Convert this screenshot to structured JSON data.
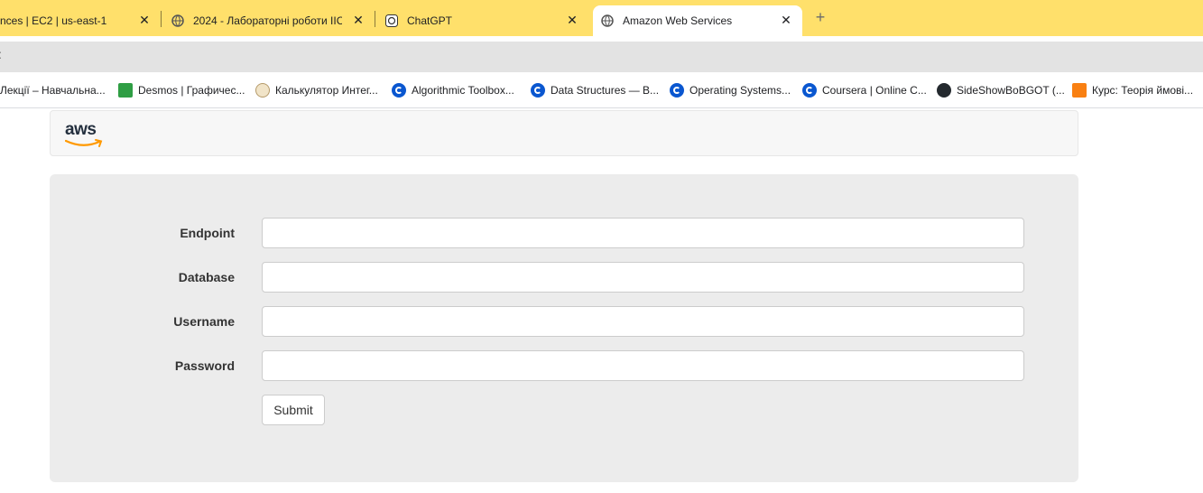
{
  "tabs": [
    {
      "title": "nces | EC2 | us-east-1",
      "active": false
    },
    {
      "title": "2024 - Лабораторні роботи ІІС",
      "active": false
    },
    {
      "title": "ChatGPT",
      "active": false
    },
    {
      "title": "Amazon Web Services",
      "active": true
    }
  ],
  "tab_close_glyph": "✕",
  "new_tab_glyph": "+",
  "omnibox_fragment": ":",
  "bookmarks": [
    {
      "label": "Лекції – Навчальна...",
      "icon": "none-icon"
    },
    {
      "label": "Desmos | Графичес...",
      "icon": "desmos-icon"
    },
    {
      "label": "Калькулятор Интег...",
      "icon": "calculator-icon"
    },
    {
      "label": "Algorithmic Toolbox...",
      "icon": "coursera-icon"
    },
    {
      "label": "Data Structures — B...",
      "icon": "coursera-icon"
    },
    {
      "label": "Operating Systems...",
      "icon": "coursera-icon"
    },
    {
      "label": "Coursera | Online C...",
      "icon": "coursera-icon"
    },
    {
      "label": "SideShowBoBGOT (...",
      "icon": "github-icon"
    },
    {
      "label": "Курс: Теорія ймові...",
      "icon": "moodle-icon"
    }
  ],
  "header": {
    "logo_text": "aws"
  },
  "form": {
    "fields": [
      {
        "label": "Endpoint",
        "value": ""
      },
      {
        "label": "Database",
        "value": ""
      },
      {
        "label": "Username",
        "value": ""
      },
      {
        "label": "Password",
        "value": ""
      }
    ],
    "submit_label": "Submit"
  },
  "colors": {
    "tabstrip": "#ffe06b",
    "aws_orange": "#ff9900",
    "aws_dark": "#232f3e"
  }
}
